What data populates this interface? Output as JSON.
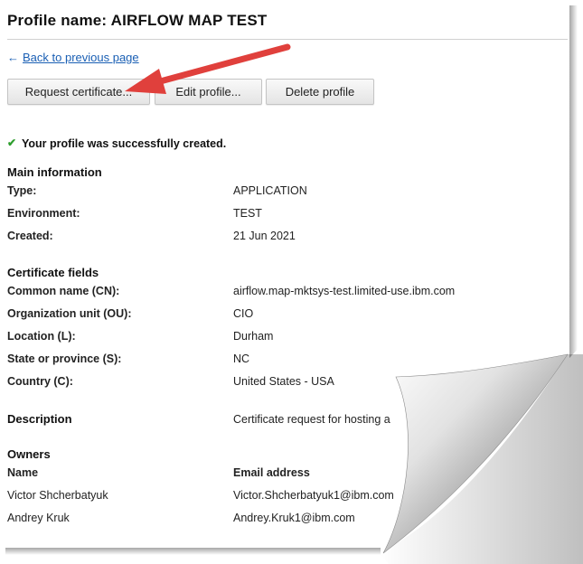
{
  "profile": {
    "title": "Profile name: AIRFLOW MAP TEST",
    "back_arrow": "←",
    "back_link": "Back to previous page"
  },
  "buttons": {
    "request": "Request certificate...",
    "edit": "Edit profile...",
    "delete": "Delete profile"
  },
  "status": {
    "check": "✔",
    "message": "Your profile was successfully created."
  },
  "main_information": {
    "heading": "Main information",
    "rows": [
      {
        "label": "Type:",
        "value": "APPLICATION"
      },
      {
        "label": "Environment:",
        "value": "TEST"
      },
      {
        "label": "Created:",
        "value": "21 Jun 2021"
      }
    ]
  },
  "certificate_fields": {
    "heading": "Certificate fields",
    "rows": [
      {
        "label": "Common name (CN):",
        "value": "airflow.map-mktsys-test.limited-use.ibm.com"
      },
      {
        "label": "Organization unit (OU):",
        "value": "CIO"
      },
      {
        "label": "Location (L):",
        "value": "Durham"
      },
      {
        "label": "State or province (S):",
        "value": "NC"
      },
      {
        "label": "Country (C):",
        "value": "United States - USA"
      }
    ]
  },
  "description": {
    "label": "Description",
    "value": "Certificate request for hosting a"
  },
  "owners": {
    "heading": "Owners",
    "col_name": "Name",
    "col_email": "Email address",
    "rows": [
      {
        "name": "Victor Shcherbatyuk",
        "email": "Victor.Shcherbatyuk1@ibm.com"
      },
      {
        "name": "Andrey Kruk",
        "email": "Andrey.Kruk1@ibm.com"
      }
    ]
  },
  "colors": {
    "link": "#1a5fb4",
    "success_check": "#2e9e2e",
    "callout_arrow": "#e0403c"
  }
}
